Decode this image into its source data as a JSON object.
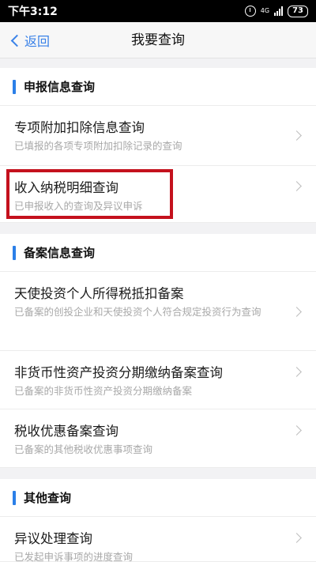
{
  "status": {
    "time": "下午3:12",
    "network": "4G",
    "battery": "73"
  },
  "nav": {
    "back_label": "返回",
    "title": "我要查询"
  },
  "sections": [
    {
      "title": "申报信息查询",
      "items": [
        {
          "title": "专项附加扣除信息查询",
          "desc": "已填报的各项专项附加扣除记录的查询"
        },
        {
          "title": "收入纳税明细查询",
          "desc": "已申报收入的查询及异议申诉"
        }
      ]
    },
    {
      "title": "备案信息查询",
      "items": [
        {
          "title": "天使投资个人所得税抵扣备案",
          "desc": "已备案的创投企业和天使投资个人符合规定投资行为查询"
        },
        {
          "title": "非货币性资产投资分期缴纳备案查询",
          "desc": "已备案的非货币性资产投资分期缴纳备案"
        },
        {
          "title": "税收优惠备案查询",
          "desc": "已备案的其他税收优惠事项查询"
        }
      ]
    },
    {
      "title": "其他查询",
      "items": [
        {
          "title": "异议处理查询",
          "desc": "已发起申诉事项的进度查询"
        }
      ]
    }
  ],
  "colors": {
    "accent": "#2b7fe8",
    "link": "#3a82e8",
    "highlight": "#c4111d"
  }
}
